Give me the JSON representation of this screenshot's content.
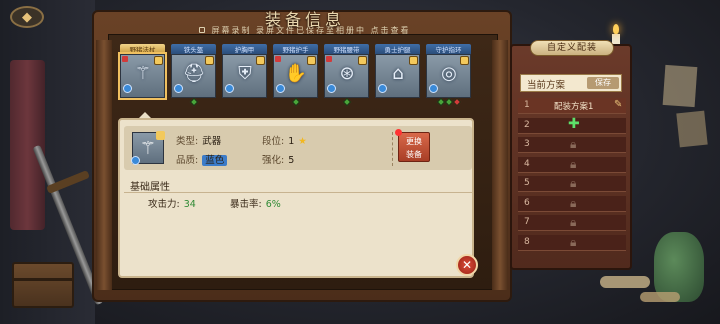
{
  "header": {
    "title": "装备信息",
    "subtitle": "屏幕录制  录屏文件已保存至相册中  点击查看"
  },
  "slots": [
    {
      "label": "野猪法杖",
      "icon": "staff-icon",
      "selected": true,
      "diamonds": []
    },
    {
      "label": "铁头盔",
      "icon": "helmet-icon",
      "selected": false,
      "diamonds": [
        "#49a53a"
      ]
    },
    {
      "label": "护胸甲",
      "icon": "armor-icon",
      "selected": false,
      "diamonds": []
    },
    {
      "label": "野猪护手",
      "icon": "gauntlet-icon",
      "selected": false,
      "diamonds": [
        "#49a53a"
      ]
    },
    {
      "label": "野猪腰带",
      "icon": "belt-icon",
      "selected": false,
      "diamonds": [
        "#49a53a"
      ]
    },
    {
      "label": "勇士护腿",
      "icon": "greaves-icon",
      "selected": false,
      "diamonds": []
    },
    {
      "label": "守护指环",
      "icon": "ring-icon",
      "selected": false,
      "diamonds": [
        "#49a53a",
        "#49a53a",
        "#d23a3a"
      ]
    }
  ],
  "detail": {
    "type_label": "类型:",
    "type_value": "武器",
    "quality_label": "品质:",
    "quality_value": "蓝色",
    "tier_label": "段位:",
    "tier_value": "1",
    "enhance_label": "强化:",
    "enhance_value": "5",
    "replace_line1": "更换",
    "replace_line2": "装备"
  },
  "attributes": {
    "title": "基础属性",
    "items": [
      {
        "label": "攻击力:",
        "value": "34"
      },
      {
        "label": "暴击率:",
        "value": "6%"
      }
    ]
  },
  "config": {
    "title": "自定义配装",
    "current_plan": "当前方案",
    "save_label": "保存",
    "items": [
      {
        "num": "1",
        "name": "配装方案1",
        "icon": "pencil-icon"
      },
      {
        "num": "2",
        "name": "",
        "icon": "plus-icon"
      },
      {
        "num": "3",
        "name": "",
        "icon": "lock-icon"
      },
      {
        "num": "4",
        "name": "",
        "icon": "lock-icon"
      },
      {
        "num": "5",
        "name": "",
        "icon": "lock-icon"
      },
      {
        "num": "6",
        "name": "",
        "icon": "lock-icon"
      },
      {
        "num": "7",
        "name": "",
        "icon": "lock-icon"
      },
      {
        "num": "8",
        "name": "",
        "icon": "lock-icon"
      }
    ]
  },
  "colors": {
    "accent_gold": "#f0c060",
    "quality_blue": "#3c7cc9",
    "stat_green": "#2f8a35",
    "close_red": "#d94a3a"
  }
}
